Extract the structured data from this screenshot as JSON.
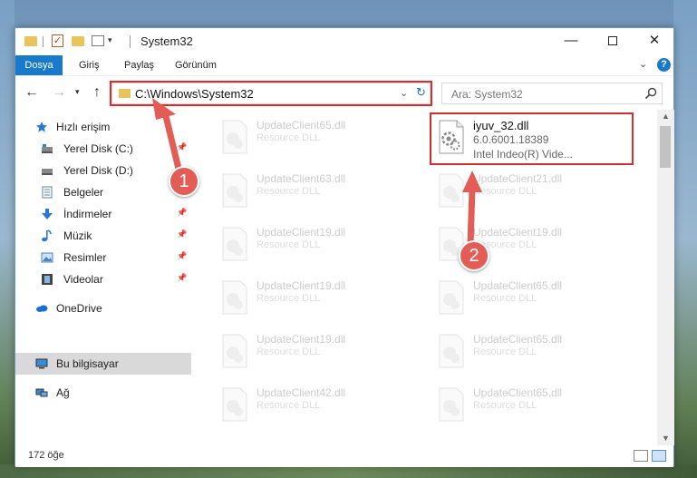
{
  "window": {
    "title": "System32",
    "min_symbol": "—",
    "close_symbol": "✕"
  },
  "ribbon": {
    "tabs": [
      "Dosya",
      "Giriş",
      "Paylaş",
      "Görünüm"
    ],
    "help": "?"
  },
  "address": {
    "path": "C:\\Windows\\System32",
    "search_placeholder": "Ara: System32"
  },
  "sidebar": {
    "quick_access": "Hızlı erişim",
    "items": [
      {
        "label": "Yerel Disk (C:)",
        "icon": "drive-icon",
        "pinned": true
      },
      {
        "label": "Yerel Disk (D:)",
        "icon": "drive-icon",
        "pinned": false
      },
      {
        "label": "Belgeler",
        "icon": "documents-icon",
        "pinned": false
      },
      {
        "label": "İndirmeler",
        "icon": "downloads-icon",
        "pinned": true
      },
      {
        "label": "Müzik",
        "icon": "music-icon",
        "pinned": true
      },
      {
        "label": "Resimler",
        "icon": "pictures-icon",
        "pinned": true
      },
      {
        "label": "Videolar",
        "icon": "videos-icon",
        "pinned": true
      }
    ],
    "onedrive": "OneDrive",
    "this_pc": "Bu bilgisayar",
    "network": "Ağ"
  },
  "files": {
    "left_column": [
      {
        "name": "UpdateClient65.dll",
        "desc": "Resource DLL"
      },
      {
        "name": "UpdateClient63.dll",
        "desc": "Resource DLL"
      },
      {
        "name": "UpdateClient19.dll",
        "desc": "Resource DLL"
      },
      {
        "name": "UpdateClient19.dll",
        "desc": "Resource DLL"
      },
      {
        "name": "UpdateClient19.dll",
        "desc": "Resource DLL"
      },
      {
        "name": "UpdateClient42.dll",
        "desc": "Resource DLL"
      }
    ],
    "selected": {
      "name": "iyuv_32.dll",
      "version": "6.0.6001.18389",
      "desc": "Intel Indeo(R) Vide..."
    },
    "right_column": [
      {
        "name": "UpdateClient21.dll",
        "desc": "Resource DLL"
      },
      {
        "name": "UpdateClient19.dll",
        "desc": "Resource DLL"
      },
      {
        "name": "UpdateClient65.dll",
        "desc": "Resource DLL"
      },
      {
        "name": "UpdateClient65.dll",
        "desc": "Resource DLL"
      },
      {
        "name": "UpdateClient65.dll",
        "desc": "Resource DLL"
      }
    ]
  },
  "status": {
    "item_count": "172 öğe"
  },
  "annotations": {
    "step1": "1",
    "step2": "2",
    "color": "#e25d55"
  }
}
